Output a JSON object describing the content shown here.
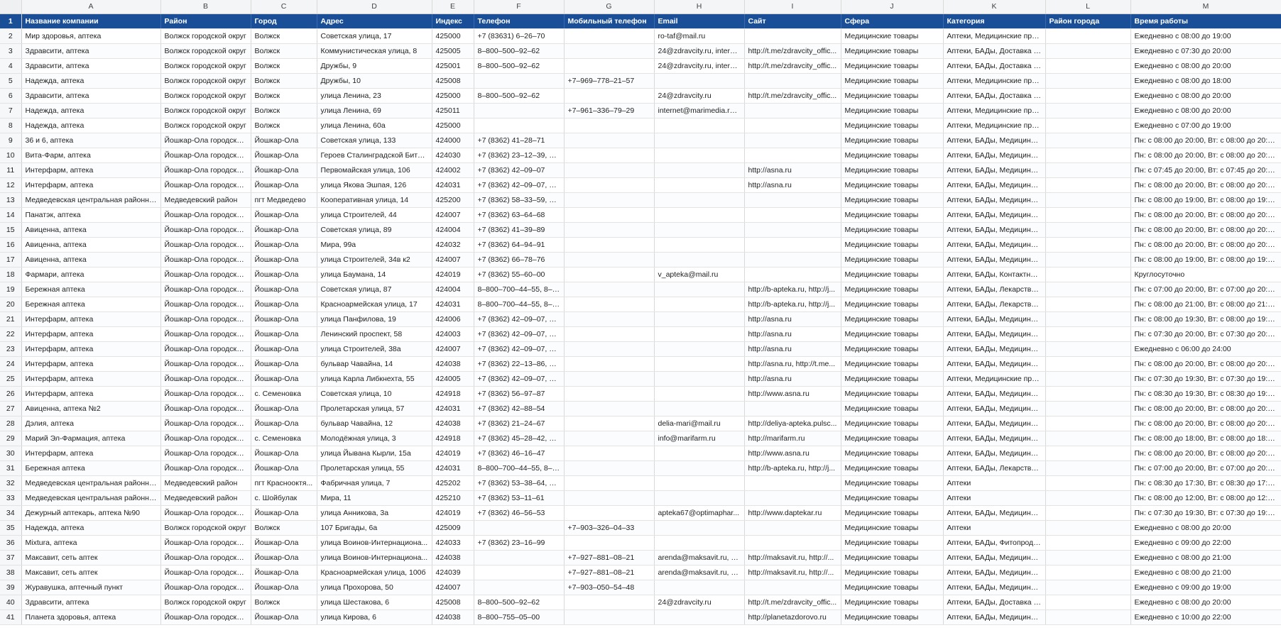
{
  "columns": [
    "A",
    "B",
    "C",
    "D",
    "E",
    "F",
    "G",
    "H",
    "I",
    "J",
    "K",
    "L",
    "M"
  ],
  "header_row_number": "1",
  "headers": [
    "Название компании",
    "Район",
    "Город",
    "Адрес",
    "Индекс",
    "Телефон",
    "Мобильный телефон",
    "Email",
    "Сайт",
    "Сфера",
    "Категория",
    "Район города",
    "Время работы"
  ],
  "rows": [
    {
      "n": "2",
      "c": [
        "Мир здоровья, аптека",
        "Волжск городской округ",
        "Волжск",
        "Советская улица, 17",
        "425000",
        "+7 (83631) 6–26–70",
        "",
        "ro-taf@mail.ru",
        "",
        "Медицинские товары",
        "Аптеки, Медицинские при...",
        "",
        "Ежедневно с 08:00 до 19:00"
      ]
    },
    {
      "n": "3",
      "c": [
        "Здравсити, аптека",
        "Волжск городской округ",
        "Волжск",
        "Коммунистическая улица, 8",
        "425005",
        "8–800–500–92–62",
        "",
        "24@zdravcity.ru, interne...",
        "http://t.me/zdravcity_offic...",
        "Медицинские товары",
        "Аптеки, БАДы, Доставка ле...",
        "",
        "Ежедневно с 07:30 до 20:00"
      ]
    },
    {
      "n": "4",
      "c": [
        "Здравсити, аптека",
        "Волжск городской округ",
        "Волжск",
        "Дружбы, 9",
        "425001",
        "8–800–500–92–62",
        "",
        "24@zdravcity.ru, interne...",
        "http://t.me/zdravcity_offic...",
        "Медицинские товары",
        "Аптеки, БАДы, Доставка ле...",
        "",
        "Ежедневно с 08:00 до 20:00"
      ]
    },
    {
      "n": "5",
      "c": [
        "Надежда, аптека",
        "Волжск городской округ",
        "Волжск",
        "Дружбы, 10",
        "425008",
        "",
        "+7–969–778–21–57",
        "",
        "",
        "Медицинские товары",
        "Аптеки, Медицинские при...",
        "",
        "Ежедневно с 08:00 до 18:00"
      ]
    },
    {
      "n": "6",
      "c": [
        "Здравсити, аптека",
        "Волжск городской округ",
        "Волжск",
        "улица Ленина, 23",
        "425000",
        "8–800–500–92–62",
        "",
        "24@zdravcity.ru",
        "http://t.me/zdravcity_offic...",
        "Медицинские товары",
        "Аптеки, БАДы, Доставка ле...",
        "",
        "Ежедневно с 08:00 до 20:00"
      ]
    },
    {
      "n": "7",
      "c": [
        "Надежда, аптека",
        "Волжск городской округ",
        "Волжск",
        "улица Ленина, 69",
        "425011",
        "",
        "+7–961–336–79–29",
        "internet@marimedia.ru,...",
        "",
        "Медицинские товары",
        "Аптеки, Медицинские при...",
        "",
        "Ежедневно с 08:00 до 20:00"
      ]
    },
    {
      "n": "8",
      "c": [
        "Надежда, аптека",
        "Волжск городской округ",
        "Волжск",
        "улица Ленина, 60а",
        "425000",
        "",
        "",
        "",
        "",
        "Медицинские товары",
        "Аптеки, Медицинские при...",
        "",
        "Ежедневно с 07:00 до 19:00"
      ]
    },
    {
      "n": "9",
      "c": [
        "36 и 6, аптека",
        "Йошкар-Ола городско...",
        "Йошкар-Ола",
        "Советская улица, 133",
        "424000",
        "+7 (8362) 41–28–71",
        "",
        "",
        "",
        "Медицинские товары",
        "Аптеки, БАДы, Медицинск...",
        "",
        "Пн: с 08:00 до 20:00, Вт: с 08:00 до 20:00, С..."
      ]
    },
    {
      "n": "10",
      "c": [
        "Вита-Фарм, аптека",
        "Йошкар-Ола городско...",
        "Йошкар-Ола",
        "Героев Сталинградской Битвы...",
        "424030",
        "+7 (8362) 23–12–39, +7...",
        "",
        "",
        "",
        "Медицинские товары",
        "Аптеки, БАДы, Медицинск...",
        "",
        "Пн: с 08:00 до 20:00, Вт: с 08:00 до 20:00, С..."
      ]
    },
    {
      "n": "11",
      "c": [
        "Интерфарм, аптека",
        "Йошкар-Ола городско...",
        "Йошкар-Ола",
        "Первомайская улица, 106",
        "424002",
        "+7 (8362) 42–09–07",
        "",
        "",
        "http://asna.ru",
        "Медицинские товары",
        "Аптеки, БАДы, Медицинск...",
        "",
        "Пн: с 07:45 до 20:00, Вт: с 07:45 до 20:00, С..."
      ]
    },
    {
      "n": "12",
      "c": [
        "Интерфарм, аптека",
        "Йошкар-Ола городско...",
        "Йошкар-Ола",
        "улица Якова Эшпая, 126",
        "424031",
        "+7 (8362) 42–09–07, +7...",
        "",
        "",
        "http://asna.ru",
        "Медицинские товары",
        "Аптеки, БАДы, Медицинск...",
        "",
        "Пн: с 08:00 до 20:00, Вт: с 08:00 до 20:00, С..."
      ]
    },
    {
      "n": "13",
      "c": [
        "Медведевская центральная районная...",
        "Медведевский район",
        "пгт Медведево",
        "Кооперативная улица, 14",
        "425200",
        "+7 (8362) 58–33–59, +7...",
        "",
        "",
        "",
        "Медицинские товары",
        "Аптеки, БАДы, Медицинск...",
        "",
        "Пн: с 08:00 до 19:00, Вт: с 08:00 до 19:00, С..."
      ]
    },
    {
      "n": "14",
      "c": [
        "Панатэк, аптека",
        "Йошкар-Ола городско...",
        "Йошкар-Ола",
        "улица Строителей, 44",
        "424007",
        "+7 (8362) 63–64–68",
        "",
        "",
        "",
        "Медицинские товары",
        "Аптеки, БАДы, Медицинск...",
        "",
        "Пн: с 08:00 до 20:00, Вт: с 08:00 до 20:00, С..."
      ]
    },
    {
      "n": "15",
      "c": [
        "Авиценна, аптека",
        "Йошкар-Ола городско...",
        "Йошкар-Ола",
        "Советская улица, 89",
        "424004",
        "+7 (8362) 41–39–89",
        "",
        "",
        "",
        "Медицинские товары",
        "Аптеки, БАДы, Медицинск...",
        "",
        "Пн: с 08:00 до 20:00, Вт: с 08:00 до 20:00, С..."
      ]
    },
    {
      "n": "16",
      "c": [
        "Авиценна, аптека",
        "Йошкар-Ола городско...",
        "Йошкар-Ола",
        "Мира, 99а",
        "424032",
        "+7 (8362) 64–94–91",
        "",
        "",
        "",
        "Медицинские товары",
        "Аптеки, БАДы, Медицинск...",
        "",
        "Пн: с 08:00 до 20:00, Вт: с 08:00 до 20:00, С..."
      ]
    },
    {
      "n": "17",
      "c": [
        "Авиценна, аптека",
        "Йошкар-Ола городско...",
        "Йошкар-Ола",
        "улица Строителей, 34в к2",
        "424007",
        "+7 (8362) 66–78–76",
        "",
        "",
        "",
        "Медицинские товары",
        "Аптеки, БАДы, Медицинск...",
        "",
        "Пн: с 08:00 до 19:00, Вт: с 08:00 до 19:00, С..."
      ]
    },
    {
      "n": "18",
      "c": [
        "Фармари, аптека",
        "Йошкар-Ола городско...",
        "Йошкар-Ола",
        "улица Баумана, 14",
        "424019",
        "+7 (8362) 55–60–00",
        "",
        "v_apteka@mail.ru",
        "",
        "Медицинские товары",
        "Аптеки, БАДы, Контактные...",
        "",
        "Круглосуточно"
      ]
    },
    {
      "n": "19",
      "c": [
        "Бережная аптека",
        "Йошкар-Ола городско...",
        "Йошкар-Ола",
        "Советская улица, 87",
        "424004",
        "8–800–700–44–55, 8–8...",
        "",
        "",
        "http://b-apteka.ru, http://j...",
        "Медицинские товары",
        "Аптеки, БАДы, Лекарства -...",
        "",
        "Пн: с 07:00 до 20:00, Вт: с 07:00 до 20:00, С..."
      ]
    },
    {
      "n": "20",
      "c": [
        "Бережная аптека",
        "Йошкар-Ола городско...",
        "Йошкар-Ола",
        "Красноармейская улица, 17",
        "424031",
        "8–800–700–44–55, 8–8...",
        "",
        "",
        "http://b-apteka.ru, http://j...",
        "Медицинские товары",
        "Аптеки, БАДы, Лекарства -...",
        "",
        "Пн: с 08:00 до 21:00, Вт: с 08:00 до 21:00, С..."
      ]
    },
    {
      "n": "21",
      "c": [
        "Интерфарм, аптека",
        "Йошкар-Ола городско...",
        "Йошкар-Ола",
        "улица Панфилова, 19",
        "424006",
        "+7 (8362) 42–09–07, +7...",
        "",
        "",
        "http://asna.ru",
        "Медицинские товары",
        "Аптеки, БАДы, Медицинск...",
        "",
        "Пн: с 08:00 до 19:30, Вт: с 08:00 до 19:30, С..."
      ]
    },
    {
      "n": "22",
      "c": [
        "Интерфарм, аптека",
        "Йошкар-Ола городско...",
        "Йошкар-Ола",
        "Ленинский проспект, 58",
        "424003",
        "+7 (8362) 42–09–07, +7...",
        "",
        "",
        "http://asna.ru",
        "Медицинские товары",
        "Аптеки, БАДы, Медицинск...",
        "",
        "Пн: с 07:30 до 20:00, Вт: с 07:30 до 20:00, С..."
      ]
    },
    {
      "n": "23",
      "c": [
        "Интерфарм, аптека",
        "Йошкар-Ола городско...",
        "Йошкар-Ола",
        "улица Строителей, 38а",
        "424007",
        "+7 (8362) 42–09–07, +7...",
        "",
        "",
        "http://asna.ru",
        "Медицинские товары",
        "Аптеки, БАДы, Медицинск...",
        "",
        "Ежедневно с 06:00 до 24:00"
      ]
    },
    {
      "n": "24",
      "c": [
        "Интерфарм, аптека",
        "Йошкар-Ола городско...",
        "Йошкар-Ола",
        "бульвар Чавайна, 14",
        "424038",
        "+7 (8362) 22–13–86, +7...",
        "",
        "",
        "http://asna.ru, http://t.me...",
        "Медицинские товары",
        "Аптеки, БАДы, Медицинск...",
        "",
        "Пн: с 08:00 до 20:00, Вт: с 08:00 до 20:00, С..."
      ]
    },
    {
      "n": "25",
      "c": [
        "Интерфарм, аптека",
        "Йошкар-Ола городско...",
        "Йошкар-Ола",
        "улица Карла Либкнехта, 55",
        "424005",
        "+7 (8362) 42–09–07, +7...",
        "",
        "",
        "http://asna.ru",
        "Медицинские товары",
        "Аптеки, Медицинские при...",
        "",
        "Пн: с 07:30 до 19:30, Вт: с 07:30 до 19:30, С..."
      ]
    },
    {
      "n": "26",
      "c": [
        "Интерфарм, аптека",
        "Йошкар-Ола городско...",
        "с. Семеновка",
        "Советская улица, 10",
        "424918",
        "+7 (8362) 56–97–87",
        "",
        "",
        "http://www.asna.ru",
        "Медицинские товары",
        "Аптеки, БАДы, Медицинск...",
        "",
        "Пн: с 08:30 до 19:30, Вт: с 08:30 до 19:30, С..."
      ]
    },
    {
      "n": "27",
      "c": [
        "Авиценна, аптека №2",
        "Йошкар-Ола городско...",
        "Йошкар-Ола",
        "Пролетарская улица, 57",
        "424031",
        "+7 (8362) 42–88–54",
        "",
        "",
        "",
        "Медицинские товары",
        "Аптеки, БАДы, Медицинск...",
        "",
        "Пн: с 08:00 до 20:00, Вт: с 08:00 до 20:00, С..."
      ]
    },
    {
      "n": "28",
      "c": [
        "Дэлия, аптека",
        "Йошкар-Ола городско...",
        "Йошкар-Ола",
        "бульвар Чавайна, 12",
        "424038",
        "+7 (8362) 21–24–67",
        "",
        "delia-mari@mail.ru",
        "http://deliya-apteka.pulsc...",
        "Медицинские товары",
        "Аптеки, БАДы, Медицинск...",
        "",
        "Пн: с 08:00 до 20:00, Вт: с 08:00 до 20:00, С..."
      ]
    },
    {
      "n": "29",
      "c": [
        "Марий Эл-Фармация, аптека",
        "Йошкар-Ола городско...",
        "с. Семеновка",
        "Молодёжная улица, 3",
        "424918",
        "+7 (8362) 45–28–42, +7...",
        "",
        "info@marifarm.ru",
        "http://marifarm.ru",
        "Медицинские товары",
        "Аптеки, БАДы, Медицинск...",
        "",
        "Пн: с 08:00 до 18:00, Вт: с 08:00 до 18:00, С..."
      ]
    },
    {
      "n": "30",
      "c": [
        "Интерфарм, аптека",
        "Йошкар-Ола городско...",
        "Йошкар-Ола",
        "улица Йывана Кырли, 15а",
        "424019",
        "+7 (8362) 46–16–47",
        "",
        "",
        "http://www.asna.ru",
        "Медицинские товары",
        "Аптеки, БАДы, Медицинск...",
        "",
        "Пн: с 08:00 до 20:00, Вт: с 08:00 до 20:00, С..."
      ]
    },
    {
      "n": "31",
      "c": [
        "Бережная аптека",
        "Йошкар-Ола городско...",
        "Йошкар-Ола",
        "Пролетарская улица, 55",
        "424031",
        "8–800–700–44–55, 8–8...",
        "",
        "",
        "http://b-apteka.ru, http://j...",
        "Медицинские товары",
        "Аптеки, БАДы, Лекарства -...",
        "",
        "Пн: с 07:00 до 20:00, Вт: с 07:00 до 20:00, С..."
      ]
    },
    {
      "n": "32",
      "c": [
        "Медведевская центральная районная...",
        "Медведевский район",
        "пгт Краснооктя...",
        "Фабричная улица, 7",
        "425202",
        "+7 (8362) 53–38–64, +7...",
        "",
        "",
        "",
        "Медицинские товары",
        "Аптеки",
        "",
        "Пн: с 08:30 до 17:30, Вт: с 08:30 до 17:30, С..."
      ]
    },
    {
      "n": "33",
      "c": [
        "Медведевская центральная районная...",
        "Медведевский район",
        "с. Шойбулак",
        "Мира, 11",
        "425210",
        "+7 (8362) 53–11–61",
        "",
        "",
        "",
        "Медицинские товары",
        "Аптеки",
        "",
        "Пн: с 08:00 до 12:00, Вт: с 08:00 до 12:00, С..."
      ]
    },
    {
      "n": "34",
      "c": [
        "Дежурный аптекарь, аптека №90",
        "Йошкар-Ола городско...",
        "Йошкар-Ола",
        "улица Анникова, 3а",
        "424019",
        "+7 (8362) 46–56–53",
        "",
        "apteka67@optimaphar...",
        "http://www.daptekar.ru",
        "Медицинские товары",
        "Аптеки, БАДы, Медицинск...",
        "",
        "Пн: с 07:30 до 19:30, Вт: с 07:30 до 19:30, С..."
      ]
    },
    {
      "n": "35",
      "c": [
        "Надежда, аптека",
        "Волжск городской округ",
        "Волжск",
        "107 Бригады, 6а",
        "425009",
        "",
        "+7–903–326–04–33",
        "",
        "",
        "Медицинские товары",
        "Аптеки",
        "",
        "Ежедневно с 08:00 до 20:00"
      ]
    },
    {
      "n": "36",
      "c": [
        "Mixtura, аптека",
        "Йошкар-Ола городско...",
        "Йошкар-Ола",
        "улица Воинов-Интернациона...",
        "424033",
        "+7 (8362) 23–16–99",
        "",
        "",
        "",
        "Медицинские товары",
        "Аптеки, БАДы, Фитопроду...",
        "",
        "Ежедневно с 09:00 до 22:00"
      ]
    },
    {
      "n": "37",
      "c": [
        "Максавит, сеть аптек",
        "Йошкар-Ола городско...",
        "Йошкар-Ола",
        "улица Воинов-Интернациона...",
        "424038",
        "",
        "+7–927–881–08–21",
        "arenda@maksavit.ru, cli...",
        "http://maksavit.ru, http://...",
        "Медицинские товары",
        "Аптеки, БАДы, Медицинск...",
        "",
        "Ежедневно с 08:00 до 21:00"
      ]
    },
    {
      "n": "38",
      "c": [
        "Максавит, сеть аптек",
        "Йошкар-Ола городско...",
        "Йошкар-Ола",
        "Красноармейская улица, 100б",
        "424039",
        "",
        "+7–927–881–08–21",
        "arenda@maksavit.ru, cli...",
        "http://maksavit.ru, http://...",
        "Медицинские товары",
        "Аптеки, БАДы, Медицинск...",
        "",
        "Ежедневно с 08:00 до 21:00"
      ]
    },
    {
      "n": "39",
      "c": [
        "Журавушка, аптечный пункт",
        "Йошкар-Ола городско...",
        "Йошкар-Ола",
        "улица Прохорова, 50",
        "424007",
        "",
        "+7–903–050–54–48",
        "",
        "",
        "Медицинские товары",
        "Аптеки, БАДы, Медицинск...",
        "",
        "Ежедневно с 09:00 до 19:00"
      ]
    },
    {
      "n": "40",
      "c": [
        "Здравсити, аптека",
        "Волжск городской округ",
        "Волжск",
        "улица Шестакова, 6",
        "425008",
        "8–800–500–92–62",
        "",
        "24@zdravcity.ru",
        "http://t.me/zdravcity_offic...",
        "Медицинские товары",
        "Аптеки, БАДы, Доставка ле...",
        "",
        "Ежедневно с 08:00 до 20:00"
      ]
    },
    {
      "n": "41",
      "c": [
        "Планета здоровья, аптека",
        "Йошкар-Ола городско...",
        "Йошкар-Ола",
        "улица Кирова, 6",
        "424038",
        "8–800–755–05–00",
        "",
        "",
        "http://planetazdorovo.ru",
        "Медицинские товары",
        "Аптеки, БАДы, Медицинск...",
        "",
        "Ежедневно с 10:00 до 22:00"
      ]
    }
  ]
}
